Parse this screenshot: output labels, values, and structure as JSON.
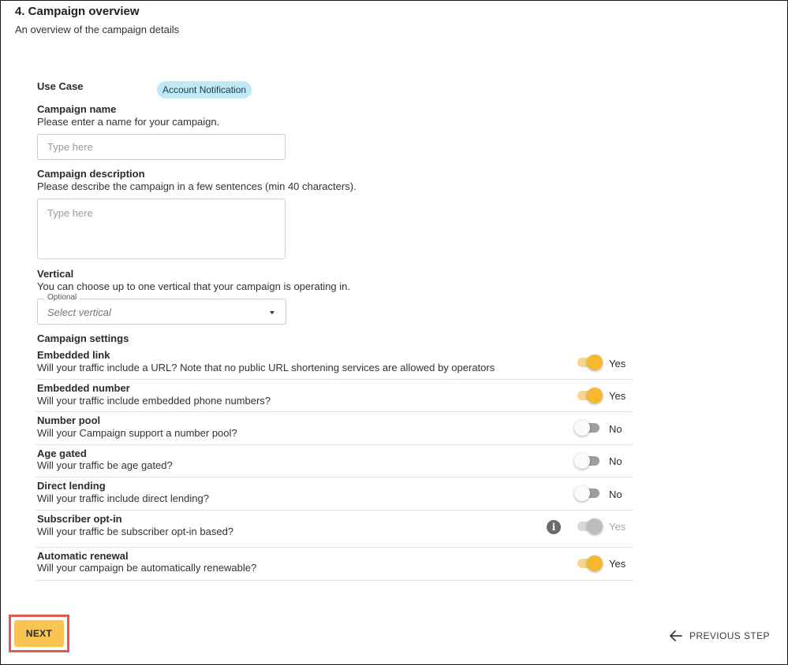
{
  "section": {
    "title": "4. Campaign overview",
    "subtitle": "An overview of the campaign details"
  },
  "use_case": {
    "label": "Use Case",
    "value": "Account Notification"
  },
  "campaign_name": {
    "label": "Campaign name",
    "help": "Please enter a name for your campaign.",
    "placeholder": "Type here",
    "value": ""
  },
  "campaign_description": {
    "label": "Campaign description",
    "help": "Please describe the campaign in a few sentences (min 40 characters).",
    "placeholder": "Type here",
    "value": ""
  },
  "vertical": {
    "label": "Vertical",
    "help": "You can choose up to one vertical that your campaign is operating in.",
    "float_label": "Optional",
    "placeholder": "Select vertical"
  },
  "settings": {
    "title": "Campaign settings",
    "items": [
      {
        "title": "Embedded link",
        "description": "Will your traffic include a URL? Note that no public URL shortening services are allowed by operators",
        "state": "on",
        "value_label": "Yes"
      },
      {
        "title": "Embedded number",
        "description": "Will your traffic include embedded phone numbers?",
        "state": "on",
        "value_label": "Yes"
      },
      {
        "title": "Number pool",
        "description": "Will your Campaign support a number pool?",
        "state": "off",
        "value_label": "No"
      },
      {
        "title": "Age gated",
        "description": "Will your traffic be age gated?",
        "state": "off",
        "value_label": "No"
      },
      {
        "title": "Direct lending",
        "description": "Will your traffic include direct lending?",
        "state": "off",
        "value_label": "No"
      },
      {
        "title": "Subscriber opt-in",
        "description": "Will your traffic be subscriber opt-in based?",
        "state": "disabled-on",
        "value_label": "Yes",
        "info_icon": "info-icon"
      },
      {
        "title": "Automatic renewal",
        "description": "Will your campaign be automatically renewable?",
        "state": "on",
        "value_label": "Yes"
      }
    ]
  },
  "footer": {
    "next_label": "NEXT",
    "previous_label": "PREVIOUS STEP",
    "previous_icon": "arrow-left-icon"
  },
  "colors": {
    "accent": "#f5b82e",
    "next_button": "#f9c452",
    "highlight_outline": "#e15a4f",
    "chip_background": "#bfe9f5"
  }
}
